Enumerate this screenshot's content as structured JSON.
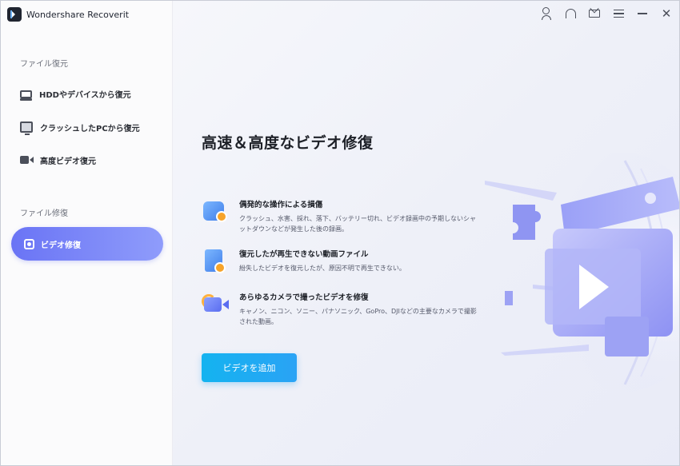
{
  "app": {
    "title": "Wondershare Recoverit"
  },
  "sidebar": {
    "section_recover": "ファイル復元",
    "section_repair": "ファイル修復",
    "items": [
      {
        "label": "HDDやデバイスから復元",
        "icon": "hdd-icon"
      },
      {
        "label": "クラッシュしたPCから復元",
        "icon": "pc-icon"
      },
      {
        "label": "高度ビデオ復元",
        "icon": "video-camera-icon"
      }
    ],
    "active_item": {
      "label": "ビデオ修復",
      "icon": "video-repair-icon"
    }
  },
  "topbar": {
    "icons": [
      "user-icon",
      "headset-icon",
      "mail-icon",
      "menu-icon",
      "minimize-icon",
      "close-icon"
    ]
  },
  "main": {
    "heading": "高速＆高度なビデオ修復",
    "features": [
      {
        "title": "偶発的な操作による損傷",
        "desc": "クラッシュ、水害、採れ、落下、バッテリー切れ、ビデオ録画中の予期しないシャットダウンなどが発生した後の録画。",
        "icon": "camera-wrench-icon"
      },
      {
        "title": "復元したが再生できない動画ファイル",
        "desc": "紛失したビデオを復元したが、原因不明で再生できない。",
        "icon": "file-wrench-icon"
      },
      {
        "title": "あらゆるカメラで撮ったビデオを修復",
        "desc": "キャノン、ニコン、ソニー、パナソニック、GoPro、DJIなどの主要なカメラで撮影された動画。",
        "icon": "video-camera-icon"
      }
    ],
    "add_button": "ビデオを追加"
  },
  "colors": {
    "accent": "#6a74f5",
    "button": "#14b3f0",
    "heading": "#1e2128"
  }
}
